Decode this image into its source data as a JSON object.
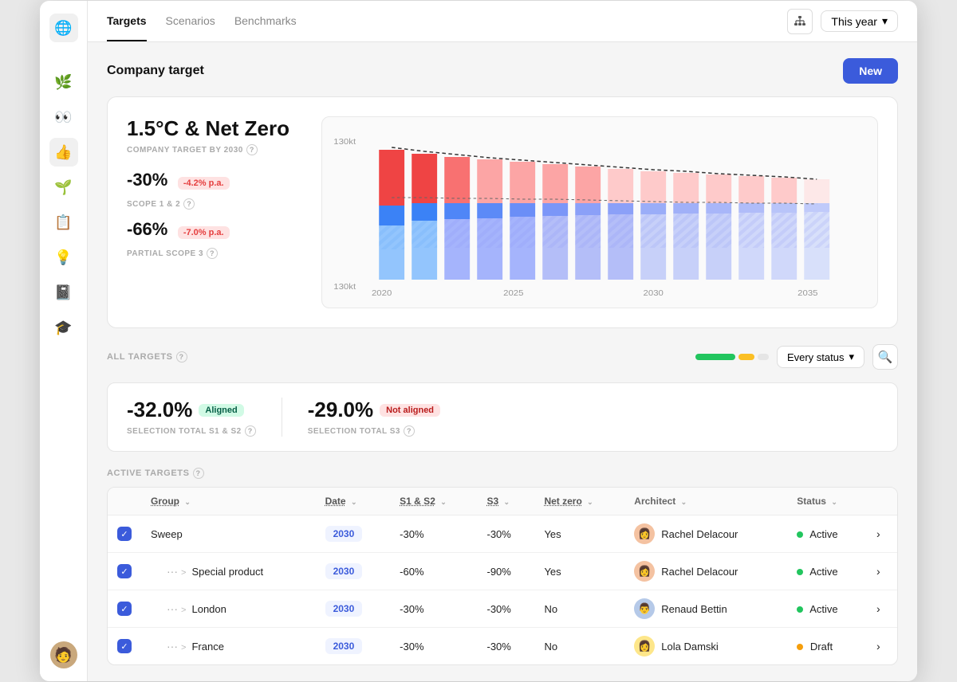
{
  "app": {
    "sidebar_icons": [
      "🌐",
      "🌿",
      "👀",
      "👍",
      "🌱",
      "📋",
      "💡",
      "📓",
      "🎓"
    ],
    "avatar_emoji": "🧑"
  },
  "topnav": {
    "tabs": [
      {
        "label": "Targets",
        "active": true
      },
      {
        "label": "Scenarios",
        "active": false
      },
      {
        "label": "Benchmarks",
        "active": false
      }
    ],
    "year_label": "This year",
    "new_button": "New"
  },
  "company_target": {
    "section_title": "Company target",
    "chart_title": "1.5°C & Net Zero",
    "chart_subtitle": "COMPANY TARGET BY 2030",
    "scope12_label": "SCOPE 1 & 2",
    "scope12_value": "-30%",
    "scope12_rate": "-4.2% p.a.",
    "scope3_label": "PARTIAL SCOPE 3",
    "scope3_value": "-66%",
    "scope3_rate": "-7.0% p.a.",
    "chart_y_top": "130kt",
    "chart_y_bottom": "130kt",
    "chart_x_labels": [
      "2020",
      "2025",
      "2030",
      "2035"
    ]
  },
  "all_targets": {
    "section_label": "ALL TARGETS",
    "status_dropdown": "Every status",
    "progress": [
      {
        "color": "#22c55e",
        "width": 48
      },
      {
        "color": "#fbbf24",
        "width": 18
      },
      {
        "color": "#e5e5e5",
        "width": 14
      }
    ],
    "selection_s1s2": {
      "value": "-32.0%",
      "badge": "Aligned",
      "label": "SELECTION TOTAL S1 & S2"
    },
    "selection_s3": {
      "value": "-29.0%",
      "badge": "Not aligned",
      "label": "SELECTION TOTAL S3"
    }
  },
  "active_targets": {
    "section_label": "ACTIVE TARGETS",
    "columns": [
      {
        "label": "Group",
        "sortable": true
      },
      {
        "label": "Date",
        "sortable": true
      },
      {
        "label": "S1 & S2",
        "sortable": true
      },
      {
        "label": "S3",
        "sortable": true
      },
      {
        "label": "Net zero",
        "sortable": true
      },
      {
        "label": "Architect",
        "sortable": true
      },
      {
        "label": "Status",
        "sortable": true
      }
    ],
    "rows": [
      {
        "checked": true,
        "indent": 0,
        "dots": false,
        "expand": false,
        "group": "Sweep",
        "date": "2030",
        "s1s2": "-30%",
        "s3": "-30%",
        "net_zero": "Yes",
        "architect_name": "Rachel Delacour",
        "architect_emoji": "👩",
        "architect_bg": "#f4c2a1",
        "status": "Active",
        "status_type": "active"
      },
      {
        "checked": true,
        "indent": 1,
        "dots": true,
        "expand": true,
        "group": "Special product",
        "date": "2030",
        "s1s2": "-60%",
        "s3": "-90%",
        "net_zero": "Yes",
        "architect_name": "Rachel Delacour",
        "architect_emoji": "👩",
        "architect_bg": "#f4c2a1",
        "status": "Active",
        "status_type": "active"
      },
      {
        "checked": true,
        "indent": 1,
        "dots": true,
        "expand": true,
        "group": "London",
        "date": "2030",
        "s1s2": "-30%",
        "s3": "-30%",
        "net_zero": "No",
        "architect_name": "Renaud Bettin",
        "architect_emoji": "👨",
        "architect_bg": "#b5c9e8",
        "status": "Active",
        "status_type": "active"
      },
      {
        "checked": true,
        "indent": 1,
        "dots": true,
        "expand": true,
        "group": "France",
        "date": "2030",
        "s1s2": "-30%",
        "s3": "-30%",
        "net_zero": "No",
        "architect_name": "Lola Damski",
        "architect_emoji": "👩",
        "architect_bg": "#fde68a",
        "status": "Draft",
        "status_type": "draft"
      }
    ]
  }
}
